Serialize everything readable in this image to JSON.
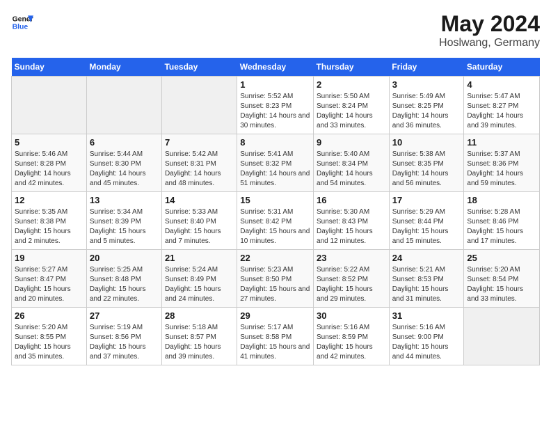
{
  "header": {
    "logo_line1": "General",
    "logo_line2": "Blue",
    "title": "May 2024",
    "subtitle": "Hoslwang, Germany"
  },
  "calendar": {
    "weekdays": [
      "Sunday",
      "Monday",
      "Tuesday",
      "Wednesday",
      "Thursday",
      "Friday",
      "Saturday"
    ],
    "weeks": [
      [
        {
          "day": "",
          "info": ""
        },
        {
          "day": "",
          "info": ""
        },
        {
          "day": "",
          "info": ""
        },
        {
          "day": "1",
          "info": "Sunrise: 5:52 AM\nSunset: 8:23 PM\nDaylight: 14 hours and 30 minutes."
        },
        {
          "day": "2",
          "info": "Sunrise: 5:50 AM\nSunset: 8:24 PM\nDaylight: 14 hours and 33 minutes."
        },
        {
          "day": "3",
          "info": "Sunrise: 5:49 AM\nSunset: 8:25 PM\nDaylight: 14 hours and 36 minutes."
        },
        {
          "day": "4",
          "info": "Sunrise: 5:47 AM\nSunset: 8:27 PM\nDaylight: 14 hours and 39 minutes."
        }
      ],
      [
        {
          "day": "5",
          "info": "Sunrise: 5:46 AM\nSunset: 8:28 PM\nDaylight: 14 hours and 42 minutes."
        },
        {
          "day": "6",
          "info": "Sunrise: 5:44 AM\nSunset: 8:30 PM\nDaylight: 14 hours and 45 minutes."
        },
        {
          "day": "7",
          "info": "Sunrise: 5:42 AM\nSunset: 8:31 PM\nDaylight: 14 hours and 48 minutes."
        },
        {
          "day": "8",
          "info": "Sunrise: 5:41 AM\nSunset: 8:32 PM\nDaylight: 14 hours and 51 minutes."
        },
        {
          "day": "9",
          "info": "Sunrise: 5:40 AM\nSunset: 8:34 PM\nDaylight: 14 hours and 54 minutes."
        },
        {
          "day": "10",
          "info": "Sunrise: 5:38 AM\nSunset: 8:35 PM\nDaylight: 14 hours and 56 minutes."
        },
        {
          "day": "11",
          "info": "Sunrise: 5:37 AM\nSunset: 8:36 PM\nDaylight: 14 hours and 59 minutes."
        }
      ],
      [
        {
          "day": "12",
          "info": "Sunrise: 5:35 AM\nSunset: 8:38 PM\nDaylight: 15 hours and 2 minutes."
        },
        {
          "day": "13",
          "info": "Sunrise: 5:34 AM\nSunset: 8:39 PM\nDaylight: 15 hours and 5 minutes."
        },
        {
          "day": "14",
          "info": "Sunrise: 5:33 AM\nSunset: 8:40 PM\nDaylight: 15 hours and 7 minutes."
        },
        {
          "day": "15",
          "info": "Sunrise: 5:31 AM\nSunset: 8:42 PM\nDaylight: 15 hours and 10 minutes."
        },
        {
          "day": "16",
          "info": "Sunrise: 5:30 AM\nSunset: 8:43 PM\nDaylight: 15 hours and 12 minutes."
        },
        {
          "day": "17",
          "info": "Sunrise: 5:29 AM\nSunset: 8:44 PM\nDaylight: 15 hours and 15 minutes."
        },
        {
          "day": "18",
          "info": "Sunrise: 5:28 AM\nSunset: 8:46 PM\nDaylight: 15 hours and 17 minutes."
        }
      ],
      [
        {
          "day": "19",
          "info": "Sunrise: 5:27 AM\nSunset: 8:47 PM\nDaylight: 15 hours and 20 minutes."
        },
        {
          "day": "20",
          "info": "Sunrise: 5:25 AM\nSunset: 8:48 PM\nDaylight: 15 hours and 22 minutes."
        },
        {
          "day": "21",
          "info": "Sunrise: 5:24 AM\nSunset: 8:49 PM\nDaylight: 15 hours and 24 minutes."
        },
        {
          "day": "22",
          "info": "Sunrise: 5:23 AM\nSunset: 8:50 PM\nDaylight: 15 hours and 27 minutes."
        },
        {
          "day": "23",
          "info": "Sunrise: 5:22 AM\nSunset: 8:52 PM\nDaylight: 15 hours and 29 minutes."
        },
        {
          "day": "24",
          "info": "Sunrise: 5:21 AM\nSunset: 8:53 PM\nDaylight: 15 hours and 31 minutes."
        },
        {
          "day": "25",
          "info": "Sunrise: 5:20 AM\nSunset: 8:54 PM\nDaylight: 15 hours and 33 minutes."
        }
      ],
      [
        {
          "day": "26",
          "info": "Sunrise: 5:20 AM\nSunset: 8:55 PM\nDaylight: 15 hours and 35 minutes."
        },
        {
          "day": "27",
          "info": "Sunrise: 5:19 AM\nSunset: 8:56 PM\nDaylight: 15 hours and 37 minutes."
        },
        {
          "day": "28",
          "info": "Sunrise: 5:18 AM\nSunset: 8:57 PM\nDaylight: 15 hours and 39 minutes."
        },
        {
          "day": "29",
          "info": "Sunrise: 5:17 AM\nSunset: 8:58 PM\nDaylight: 15 hours and 41 minutes."
        },
        {
          "day": "30",
          "info": "Sunrise: 5:16 AM\nSunset: 8:59 PM\nDaylight: 15 hours and 42 minutes."
        },
        {
          "day": "31",
          "info": "Sunrise: 5:16 AM\nSunset: 9:00 PM\nDaylight: 15 hours and 44 minutes."
        },
        {
          "day": "",
          "info": ""
        }
      ]
    ]
  }
}
